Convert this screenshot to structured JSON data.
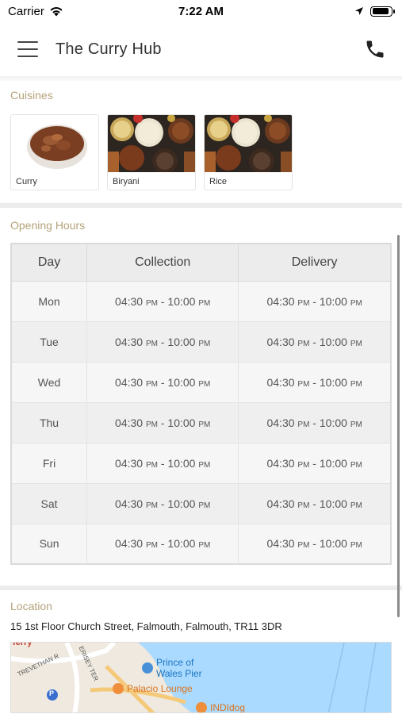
{
  "status": {
    "carrier": "Carrier",
    "time": "7:22 AM",
    "battery_level": 0.9
  },
  "header": {
    "title": "The Curry Hub"
  },
  "cuisines": {
    "section_title": "Cuisines",
    "items": [
      {
        "label": "Curry"
      },
      {
        "label": "Biryani"
      },
      {
        "label": "Rice"
      }
    ]
  },
  "hours": {
    "section_title": "Opening Hours",
    "columns": [
      "Day",
      "Collection",
      "Delivery"
    ],
    "rows": [
      {
        "day": "Mon",
        "c_open": "04:30",
        "c_ampm1": "PM",
        "c_close": "10:00",
        "c_ampm2": "PM",
        "d_open": "04:30",
        "d_ampm1": "PM",
        "d_close": "10:00",
        "d_ampm2": "PM"
      },
      {
        "day": "Tue",
        "c_open": "04:30",
        "c_ampm1": "PM",
        "c_close": "10:00",
        "c_ampm2": "PM",
        "d_open": "04:30",
        "d_ampm1": "PM",
        "d_close": "10:00",
        "d_ampm2": "PM"
      },
      {
        "day": "Wed",
        "c_open": "04:30",
        "c_ampm1": "PM",
        "c_close": "10:00",
        "c_ampm2": "PM",
        "d_open": "04:30",
        "d_ampm1": "PM",
        "d_close": "10:00",
        "d_ampm2": "PM"
      },
      {
        "day": "Thu",
        "c_open": "04:30",
        "c_ampm1": "PM",
        "c_close": "10:00",
        "c_ampm2": "PM",
        "d_open": "04:30",
        "d_ampm1": "PM",
        "d_close": "10:00",
        "d_ampm2": "PM"
      },
      {
        "day": "Fri",
        "c_open": "04:30",
        "c_ampm1": "PM",
        "c_close": "10:00",
        "c_ampm2": "PM",
        "d_open": "04:30",
        "d_ampm1": "PM",
        "d_close": "10:00",
        "d_ampm2": "PM"
      },
      {
        "day": "Sat",
        "c_open": "04:30",
        "c_ampm1": "PM",
        "c_close": "10:00",
        "c_ampm2": "PM",
        "d_open": "04:30",
        "d_ampm1": "PM",
        "d_close": "10:00",
        "d_ampm2": "PM"
      },
      {
        "day": "Sun",
        "c_open": "04:30",
        "c_ampm1": "PM",
        "c_close": "10:00",
        "c_ampm2": "PM",
        "d_open": "04:30",
        "d_ampm1": "PM",
        "d_close": "10:00",
        "d_ampm2": "PM"
      }
    ]
  },
  "location": {
    "section_title": "Location",
    "address": "15  1st Floor Church Street, Falmouth, Falmouth, TR11 3DR",
    "map_labels": {
      "pier": "Prince of",
      "pier2": "Wales Pier",
      "restaurant1": "Palacio Lounge",
      "restaurant2": "INDIdog",
      "street1": "TREVETHAN R",
      "street2": "ERISEY TER",
      "area": "ferry",
      "parking": "P"
    }
  },
  "colors": {
    "accent": "#b5a37a",
    "water": "#aadaff"
  }
}
